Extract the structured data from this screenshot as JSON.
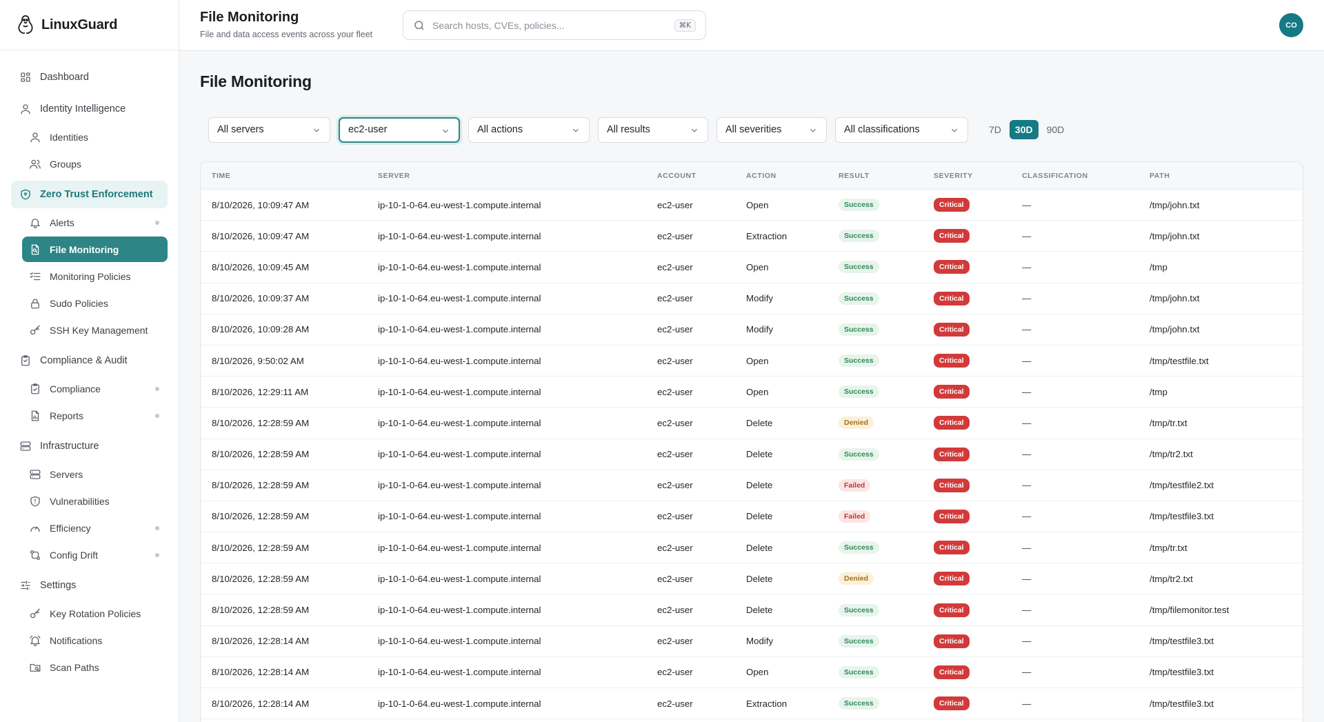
{
  "brand": {
    "name": "LinuxGuard"
  },
  "header": {
    "title": "File Monitoring",
    "subtitle": "File and data access events across your fleet",
    "search_placeholder": "Search hosts, CVEs, policies...",
    "search_shortcut": "⌘K",
    "avatar_initials": "CO"
  },
  "sidebar": {
    "items": [
      {
        "label": "Dashboard",
        "icon": "grid-icon",
        "level": 0
      },
      {
        "label": "Identity Intelligence",
        "icon": "user-icon",
        "level": 0
      },
      {
        "label": "Identities",
        "icon": "user-icon",
        "level": 1
      },
      {
        "label": "Groups",
        "icon": "users-icon",
        "level": 1
      },
      {
        "label": "Zero Trust Enforcement",
        "icon": "shield-icon",
        "level": 0,
        "state": "active-parent"
      },
      {
        "label": "Alerts",
        "icon": "bell-icon",
        "level": 1,
        "dot": true
      },
      {
        "label": "File Monitoring",
        "icon": "file-search-icon",
        "level": 1,
        "state": "active"
      },
      {
        "label": "Monitoring Policies",
        "icon": "list-checks-icon",
        "level": 1
      },
      {
        "label": "Sudo Policies",
        "icon": "lock-icon",
        "level": 1
      },
      {
        "label": "SSH Key Management",
        "icon": "key-icon",
        "level": 1
      },
      {
        "label": "Compliance & Audit",
        "icon": "clipboard-icon",
        "level": 0
      },
      {
        "label": "Compliance",
        "icon": "clipboard-check-icon",
        "level": 1,
        "dot": true
      },
      {
        "label": "Reports",
        "icon": "file-chart-icon",
        "level": 1,
        "dot": true
      },
      {
        "label": "Infrastructure",
        "icon": "server-icon",
        "level": 0
      },
      {
        "label": "Servers",
        "icon": "server-icon",
        "level": 1
      },
      {
        "label": "Vulnerabilities",
        "icon": "shield-alert-icon",
        "level": 1
      },
      {
        "label": "Efficiency",
        "icon": "gauge-icon",
        "level": 1,
        "dot": true
      },
      {
        "label": "Config Drift",
        "icon": "git-compare-icon",
        "level": 1,
        "dot": true
      },
      {
        "label": "Settings",
        "icon": "sliders-icon",
        "level": 0
      },
      {
        "label": "Key Rotation Policies",
        "icon": "key-icon",
        "level": 1
      },
      {
        "label": "Notifications",
        "icon": "bell-ring-icon",
        "level": 1
      },
      {
        "label": "Scan Paths",
        "icon": "folder-search-icon",
        "level": 1
      }
    ]
  },
  "page": {
    "title": "File Monitoring"
  },
  "filters": {
    "selects": [
      {
        "value": "All servers",
        "name": "server-filter"
      },
      {
        "value": "ec2-user",
        "name": "account-filter",
        "focused": true
      },
      {
        "value": "All actions",
        "name": "action-filter"
      },
      {
        "value": "All results",
        "name": "result-filter"
      },
      {
        "value": "All severities",
        "name": "severity-filter"
      },
      {
        "value": "All classifications",
        "name": "classification-filter"
      }
    ],
    "ranges": [
      {
        "label": "7D",
        "selected": false
      },
      {
        "label": "30D",
        "selected": true
      },
      {
        "label": "90D",
        "selected": false
      }
    ]
  },
  "table": {
    "columns": [
      "TIME",
      "SERVER",
      "ACCOUNT",
      "ACTION",
      "RESULT",
      "SEVERITY",
      "CLASSIFICATION",
      "PATH"
    ],
    "rows": [
      {
        "time": "8/10/2026, 10:09:47 AM",
        "server": "ip-10-1-0-64.eu-west-1.compute.internal",
        "account": "ec2-user",
        "action": "Open",
        "result": "Success",
        "severity": "Critical",
        "classification": "—",
        "path": "/tmp/john.txt"
      },
      {
        "time": "8/10/2026, 10:09:47 AM",
        "server": "ip-10-1-0-64.eu-west-1.compute.internal",
        "account": "ec2-user",
        "action": "Extraction",
        "result": "Success",
        "severity": "Critical",
        "classification": "—",
        "path": "/tmp/john.txt"
      },
      {
        "time": "8/10/2026, 10:09:45 AM",
        "server": "ip-10-1-0-64.eu-west-1.compute.internal",
        "account": "ec2-user",
        "action": "Open",
        "result": "Success",
        "severity": "Critical",
        "classification": "—",
        "path": "/tmp"
      },
      {
        "time": "8/10/2026, 10:09:37 AM",
        "server": "ip-10-1-0-64.eu-west-1.compute.internal",
        "account": "ec2-user",
        "action": "Modify",
        "result": "Success",
        "severity": "Critical",
        "classification": "—",
        "path": "/tmp/john.txt"
      },
      {
        "time": "8/10/2026, 10:09:28 AM",
        "server": "ip-10-1-0-64.eu-west-1.compute.internal",
        "account": "ec2-user",
        "action": "Modify",
        "result": "Success",
        "severity": "Critical",
        "classification": "—",
        "path": "/tmp/john.txt"
      },
      {
        "time": "8/10/2026, 9:50:02 AM",
        "server": "ip-10-1-0-64.eu-west-1.compute.internal",
        "account": "ec2-user",
        "action": "Open",
        "result": "Success",
        "severity": "Critical",
        "classification": "—",
        "path": "/tmp/testfile.txt"
      },
      {
        "time": "8/10/2026, 12:29:11 AM",
        "server": "ip-10-1-0-64.eu-west-1.compute.internal",
        "account": "ec2-user",
        "action": "Open",
        "result": "Success",
        "severity": "Critical",
        "classification": "—",
        "path": "/tmp"
      },
      {
        "time": "8/10/2026, 12:28:59 AM",
        "server": "ip-10-1-0-64.eu-west-1.compute.internal",
        "account": "ec2-user",
        "action": "Delete",
        "result": "Denied",
        "severity": "Critical",
        "classification": "—",
        "path": "/tmp/tr.txt"
      },
      {
        "time": "8/10/2026, 12:28:59 AM",
        "server": "ip-10-1-0-64.eu-west-1.compute.internal",
        "account": "ec2-user",
        "action": "Delete",
        "result": "Success",
        "severity": "Critical",
        "classification": "—",
        "path": "/tmp/tr2.txt"
      },
      {
        "time": "8/10/2026, 12:28:59 AM",
        "server": "ip-10-1-0-64.eu-west-1.compute.internal",
        "account": "ec2-user",
        "action": "Delete",
        "result": "Failed",
        "severity": "Critical",
        "classification": "—",
        "path": "/tmp/testfile2.txt"
      },
      {
        "time": "8/10/2026, 12:28:59 AM",
        "server": "ip-10-1-0-64.eu-west-1.compute.internal",
        "account": "ec2-user",
        "action": "Delete",
        "result": "Failed",
        "severity": "Critical",
        "classification": "—",
        "path": "/tmp/testfile3.txt"
      },
      {
        "time": "8/10/2026, 12:28:59 AM",
        "server": "ip-10-1-0-64.eu-west-1.compute.internal",
        "account": "ec2-user",
        "action": "Delete",
        "result": "Success",
        "severity": "Critical",
        "classification": "—",
        "path": "/tmp/tr.txt"
      },
      {
        "time": "8/10/2026, 12:28:59 AM",
        "server": "ip-10-1-0-64.eu-west-1.compute.internal",
        "account": "ec2-user",
        "action": "Delete",
        "result": "Denied",
        "severity": "Critical",
        "classification": "—",
        "path": "/tmp/tr2.txt"
      },
      {
        "time": "8/10/2026, 12:28:59 AM",
        "server": "ip-10-1-0-64.eu-west-1.compute.internal",
        "account": "ec2-user",
        "action": "Delete",
        "result": "Success",
        "severity": "Critical",
        "classification": "—",
        "path": "/tmp/filemonitor.test"
      },
      {
        "time": "8/10/2026, 12:28:14 AM",
        "server": "ip-10-1-0-64.eu-west-1.compute.internal",
        "account": "ec2-user",
        "action": "Modify",
        "result": "Success",
        "severity": "Critical",
        "classification": "—",
        "path": "/tmp/testfile3.txt"
      },
      {
        "time": "8/10/2026, 12:28:14 AM",
        "server": "ip-10-1-0-64.eu-west-1.compute.internal",
        "account": "ec2-user",
        "action": "Open",
        "result": "Success",
        "severity": "Critical",
        "classification": "—",
        "path": "/tmp/testfile3.txt"
      },
      {
        "time": "8/10/2026, 12:28:14 AM",
        "server": "ip-10-1-0-64.eu-west-1.compute.internal",
        "account": "ec2-user",
        "action": "Extraction",
        "result": "Success",
        "severity": "Critical",
        "classification": "—",
        "path": "/tmp/testfile3.txt"
      }
    ]
  },
  "colors": {
    "accent": "#157a83",
    "active_nav": "#2d8585",
    "success": "#2e8a55",
    "denied": "#a6701b",
    "failed": "#c0392b",
    "critical": "#d23a3a"
  }
}
